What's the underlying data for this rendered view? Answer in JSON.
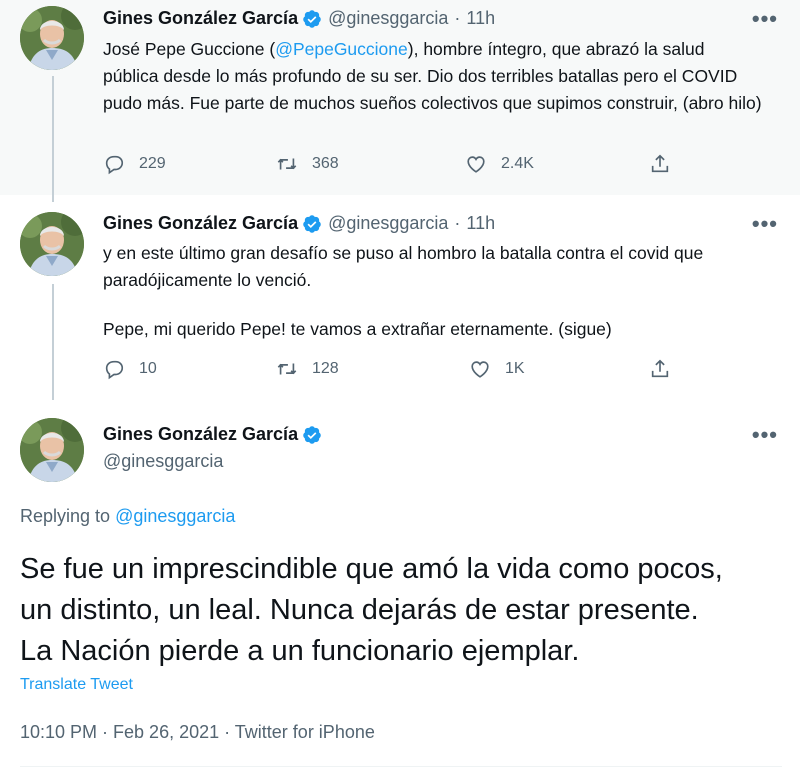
{
  "tweets": [
    {
      "name": "Gines González García",
      "handle": "@ginesggarcia",
      "sep": "·",
      "time": "11h",
      "text_pre": "José Pepe Guccione (",
      "text_mention": "@PepeGuccione",
      "text_post": "), hombre íntegro, que abrazó la salud pública desde lo más profundo de su ser. Dio dos terribles batallas pero el COVID pudo más. Fue parte de muchos sueños colectivos que supimos construir, (abro hilo)",
      "reply_count": "229",
      "retweet_count": "368",
      "like_count": "2.4K"
    },
    {
      "name": "Gines González García",
      "handle": "@ginesggarcia",
      "sep": "·",
      "time": "11h",
      "text_line1": "y en este último gran desafío se puso al hombro la batalla contra el covid que paradójicamente lo venció.",
      "text_line2": "Pepe, mi querido Pepe! te vamos a extrañar eternamente. (sigue)",
      "reply_count": "10",
      "retweet_count": "128",
      "like_count": "1K"
    }
  ],
  "main_tweet": {
    "name": "Gines González García",
    "handle": "@ginesggarcia",
    "replying_label": "Replying to",
    "replying_handle": "@ginesggarcia",
    "line1": "Se fue un imprescindible que amó la vida como pocos,",
    "line2": "un distinto, un leal. Nunca dejarás de estar presente.",
    "line3": "La Nación pierde a un funcionario ejemplar.",
    "translate_label": "Translate Tweet",
    "meta": "10:10 PM · Feb 26, 2021 · Twitter for iPhone"
  },
  "more_label": "•••",
  "colors": {
    "accent": "#1d9bf0",
    "muted": "#536471",
    "highlight_bg": "#f7f9f9"
  },
  "icons": [
    "verified-badge-icon",
    "reply-icon",
    "retweet-icon",
    "like-icon",
    "share-icon",
    "more-icon"
  ]
}
